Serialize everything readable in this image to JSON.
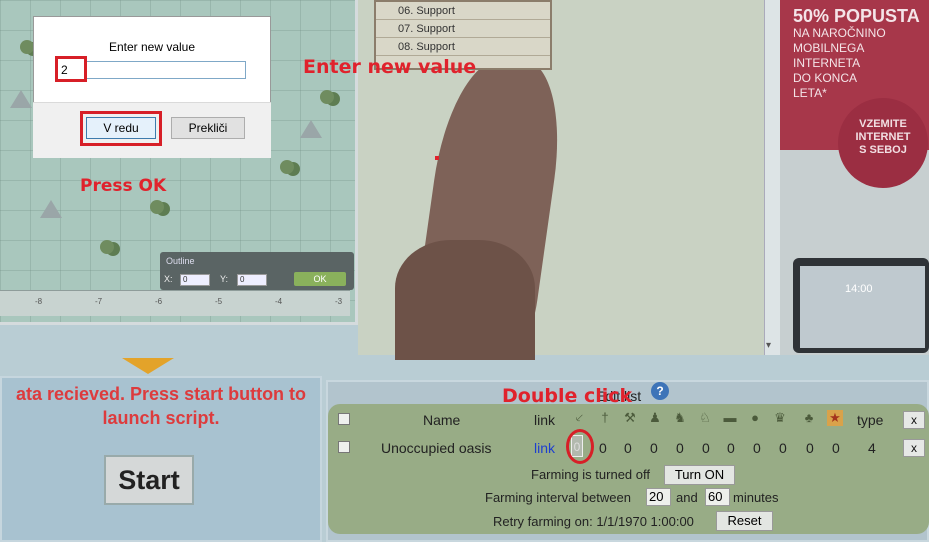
{
  "dialog": {
    "title": "Enter new value",
    "input_value": "2",
    "ok_label": "V redu",
    "cancel_label": "Prekliči"
  },
  "annotations": {
    "enter": "Enter new value",
    "press_ok": "Press OK",
    "double_click": "Double click"
  },
  "map": {
    "outline_label": "Outline",
    "x_label": "X:",
    "y_label": "Y:",
    "x_value": "0",
    "y_value": "0",
    "ok_label": "OK",
    "ruler_ticks": [
      "-8",
      "-7",
      "-6",
      "-5",
      "-4",
      "-3"
    ]
  },
  "support_list": [
    "06. Support",
    "07. Support",
    "08. Support"
  ],
  "ad": {
    "headline": "50% POPUSTA",
    "body": [
      "NA NAROČNINO",
      "MOBILNEGA",
      "INTERNETA",
      "DO KONCA",
      "LETA*"
    ],
    "circle": [
      "VZEMITE",
      "INTERNET",
      "S SEBOJ"
    ],
    "clock": "14:00"
  },
  "left_panel": {
    "status": "ata recieved. Press start button to launch script.",
    "start_label": "Start"
  },
  "right_panel": {
    "edit_label": "Edit list",
    "help_icon": "?",
    "headers": {
      "name": "Name",
      "link": "link",
      "type": "type"
    },
    "unit_icons": [
      "spear-icon",
      "sword-icon",
      "axe-icon",
      "boot-icon",
      "horse-icon",
      "horse2-icon",
      "ram-icon",
      "catapult-icon",
      "chief-icon",
      "settler-icon",
      "leaf-icon",
      "star-icon"
    ],
    "row": {
      "name": "Unoccupied oasis",
      "link": "link",
      "first_value": "0",
      "values": [
        "0",
        "0",
        "0",
        "0",
        "0",
        "0",
        "0",
        "0",
        "0",
        "0"
      ],
      "type": "4"
    },
    "x_label": "x",
    "farming_status": "Farming is turned off",
    "turn_on_label": "Turn ON",
    "interval_prefix": "Farming interval between",
    "interval_min": "20",
    "interval_and": "and",
    "interval_max": "60",
    "interval_suffix": "minutes",
    "retry_label": "Retry farming on: 1/1/1970 1:00:00",
    "reset_label": "Reset"
  }
}
